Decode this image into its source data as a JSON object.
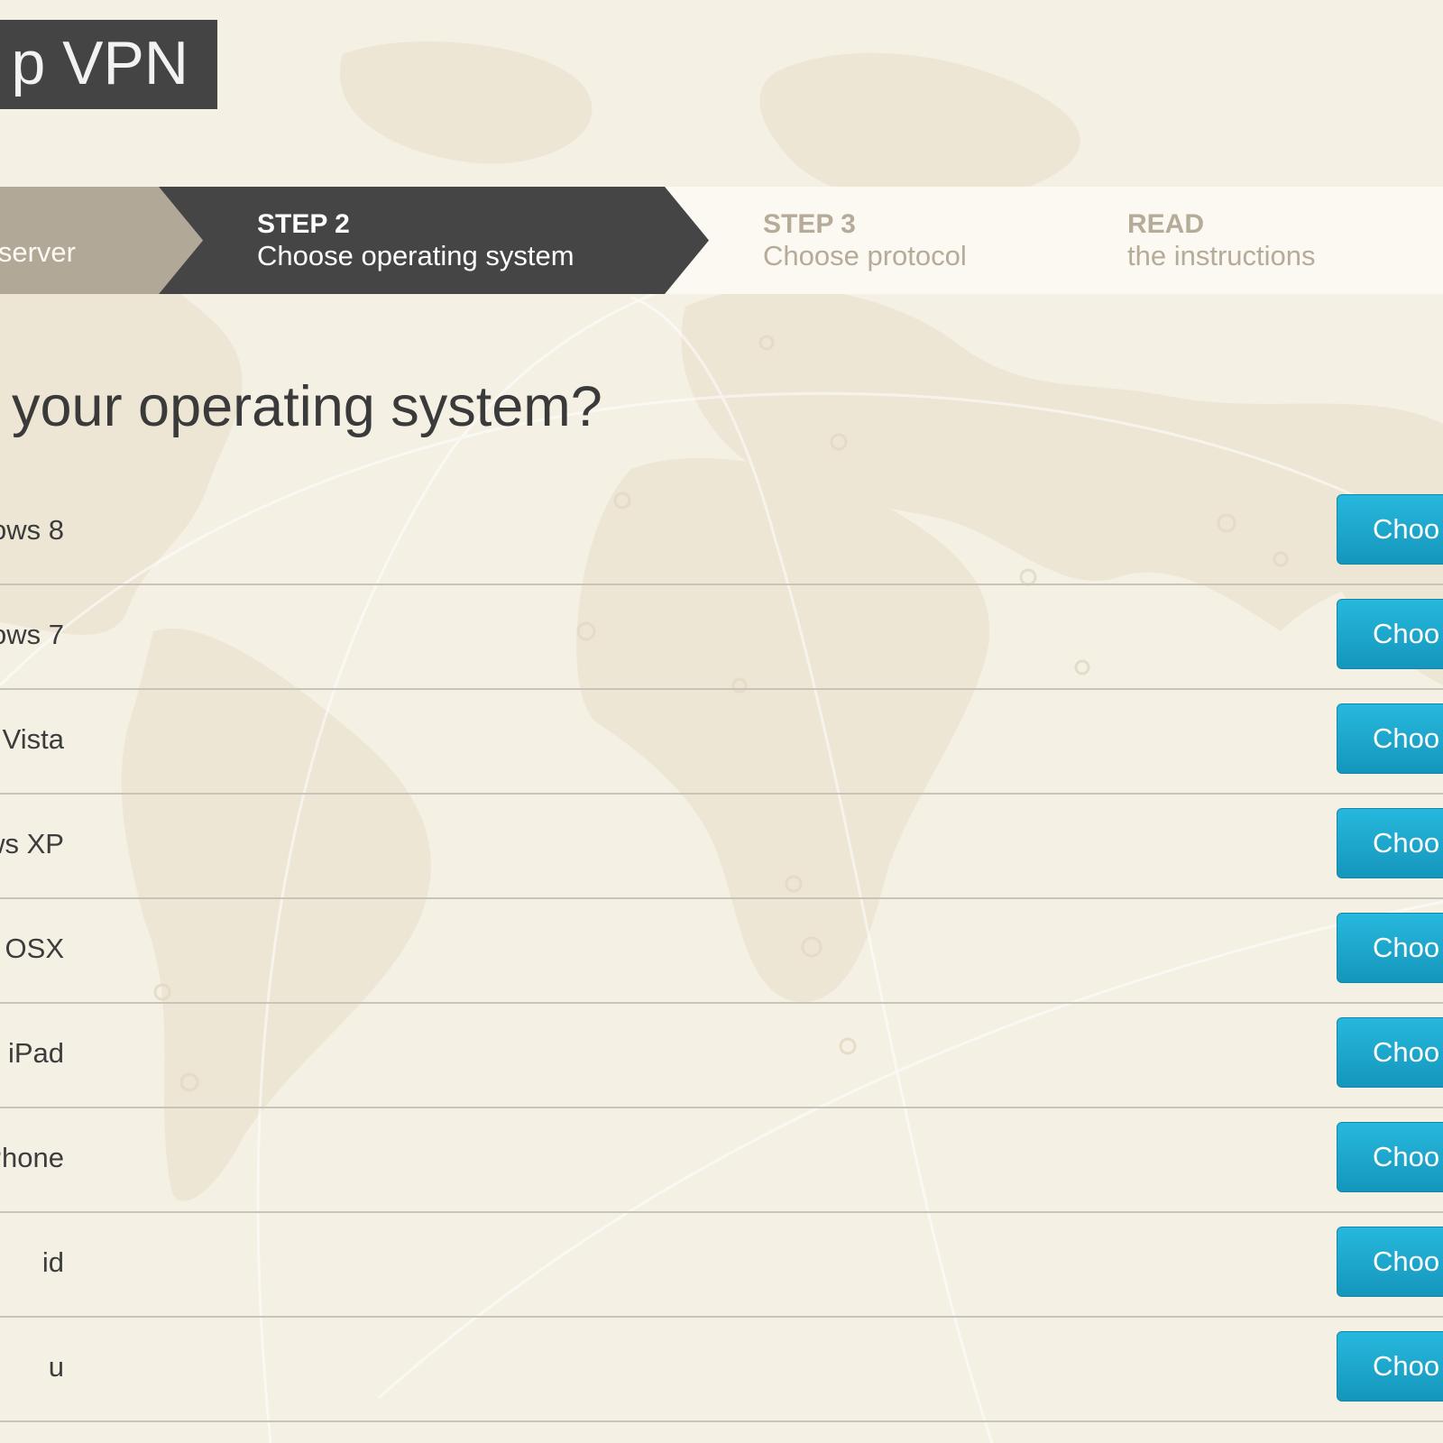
{
  "header": {
    "title": "p VPN"
  },
  "steps": [
    {
      "title": "",
      "subtitle": "e server",
      "state": "done"
    },
    {
      "title": "STEP 2",
      "subtitle": "Choose operating system",
      "state": "active"
    },
    {
      "title": "STEP 3",
      "subtitle": "Choose protocol",
      "state": "upcoming"
    },
    {
      "title": "READ",
      "subtitle": "the instructions",
      "state": "upcoming"
    }
  ],
  "main": {
    "heading": "is your operating system?",
    "os_items": [
      {
        "label": "ows 8",
        "button": "Choo"
      },
      {
        "label": "ows 7",
        "button": "Choo"
      },
      {
        "label": "ows Vista",
        "button": "Choo"
      },
      {
        "label": "ows XP",
        "button": "Choo"
      },
      {
        "label": "OSX",
        "button": "Choo"
      },
      {
        "label": "iPad",
        "button": "Choo"
      },
      {
        "label": "iPhone",
        "button": "Choo"
      },
      {
        "label": "id",
        "button": "Choo"
      },
      {
        "label": "u",
        "button": "Choo"
      }
    ]
  },
  "colors": {
    "background": "#f4f0e4",
    "title_bg": "#444444",
    "step_done": "#b2a897",
    "step_active": "#454545",
    "step_upcoming_text": "#b5ab98",
    "button": "#1ca7cf",
    "divider": "#c8c4ba"
  }
}
